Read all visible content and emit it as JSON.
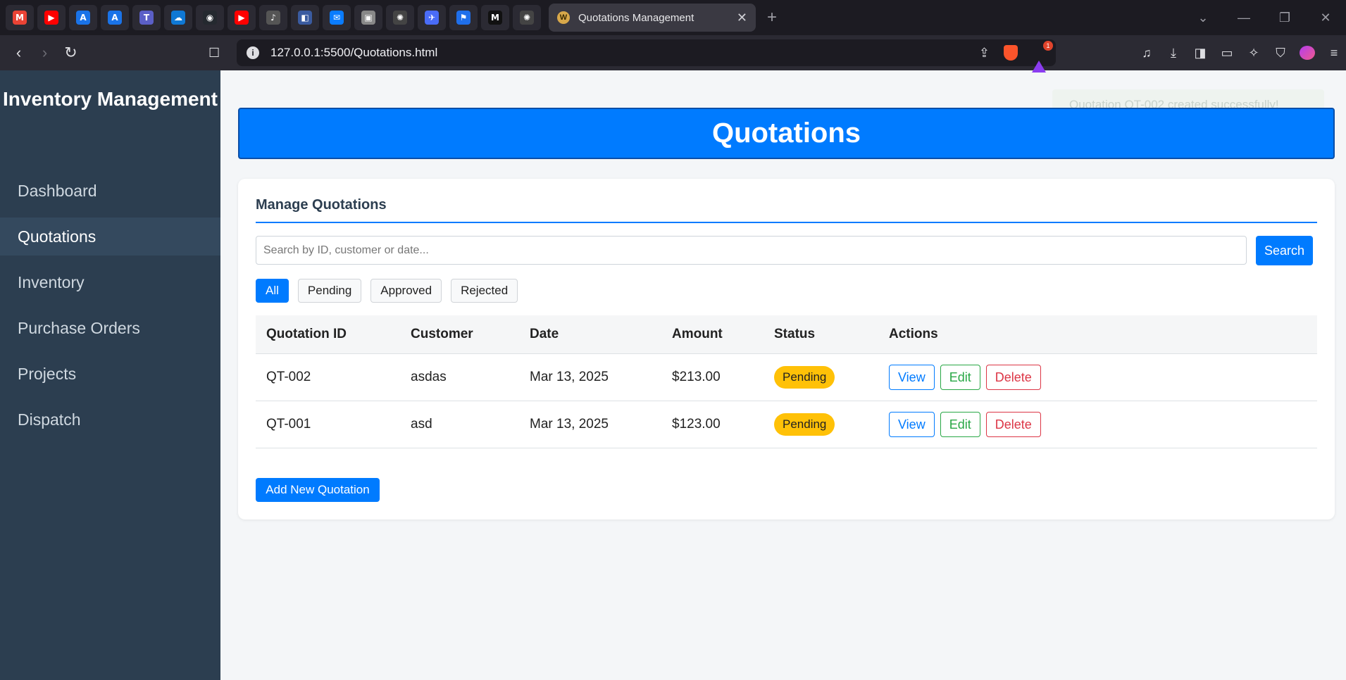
{
  "browser": {
    "pinned_tabs": [
      {
        "icon": "gmail-icon",
        "glyph": "M",
        "color": "#ea4335"
      },
      {
        "icon": "youtube-icon",
        "glyph": "▶",
        "color": "#ff0000"
      },
      {
        "icon": "app-a-icon",
        "glyph": "A",
        "color": "#1a73e8"
      },
      {
        "icon": "app-a-icon",
        "glyph": "A",
        "color": "#1a73e8"
      },
      {
        "icon": "teams-icon",
        "glyph": "T",
        "color": "#5b5fc7"
      },
      {
        "icon": "onedrive-icon",
        "glyph": "☁",
        "color": "#0f78d4"
      },
      {
        "icon": "github-icon",
        "glyph": "◉",
        "color": "#24292f"
      },
      {
        "icon": "youtube-icon",
        "glyph": "▶",
        "color": "#ff0000"
      },
      {
        "icon": "audio-icon",
        "glyph": "♪",
        "color": "#555"
      },
      {
        "icon": "app-icon",
        "glyph": "◧",
        "color": "#3a5ba0"
      },
      {
        "icon": "messenger-icon",
        "glyph": "✉",
        "color": "#0a7cff"
      },
      {
        "icon": "image-icon",
        "glyph": "▣",
        "color": "#888"
      },
      {
        "icon": "chatgpt-icon",
        "glyph": "✺",
        "color": "#444"
      },
      {
        "icon": "bird-icon",
        "glyph": "✈",
        "color": "#4a6cf7"
      },
      {
        "icon": "flag-icon",
        "glyph": "⚑",
        "color": "#1f6feb"
      },
      {
        "icon": "medium-icon",
        "glyph": "M",
        "color": "#111"
      },
      {
        "icon": "chatgpt-icon",
        "glyph": "✺",
        "color": "#444"
      }
    ],
    "active_tab_title": "Quotations Management",
    "url": "127.0.0.1:5500/Quotations.html",
    "rewards_badge": "1"
  },
  "sidebar": {
    "brand": "Inventory Management",
    "items": [
      {
        "label": "Dashboard",
        "active": false
      },
      {
        "label": "Quotations",
        "active": true
      },
      {
        "label": "Inventory",
        "active": false
      },
      {
        "label": "Purchase Orders",
        "active": false
      },
      {
        "label": "Projects",
        "active": false
      },
      {
        "label": "Dispatch",
        "active": false
      }
    ]
  },
  "toast": {
    "message": "Quotation QT-002 created successfully!"
  },
  "header": {
    "title": "Quotations"
  },
  "card": {
    "title": "Manage Quotations",
    "search": {
      "placeholder": "Search by ID, customer or date...",
      "button": "Search"
    },
    "filters": [
      {
        "label": "All",
        "active": true
      },
      {
        "label": "Pending",
        "active": false
      },
      {
        "label": "Approved",
        "active": false
      },
      {
        "label": "Rejected",
        "active": false
      }
    ],
    "table": {
      "columns": [
        "Quotation ID",
        "Customer",
        "Date",
        "Amount",
        "Status",
        "Actions"
      ],
      "rows": [
        {
          "id": "QT-002",
          "customer": "asdas",
          "date": "Mar 13, 2025",
          "amount": "$213.00",
          "status": "Pending"
        },
        {
          "id": "QT-001",
          "customer": "asd",
          "date": "Mar 13, 2025",
          "amount": "$123.00",
          "status": "Pending"
        }
      ],
      "actions": {
        "view": "View",
        "edit": "Edit",
        "delete": "Delete"
      }
    },
    "add_button": "Add New Quotation"
  },
  "colors": {
    "primary": "#007bff",
    "sidebar": "#2c3e50",
    "pending": "#ffc107",
    "success": "#28a745",
    "danger": "#dc3545"
  }
}
